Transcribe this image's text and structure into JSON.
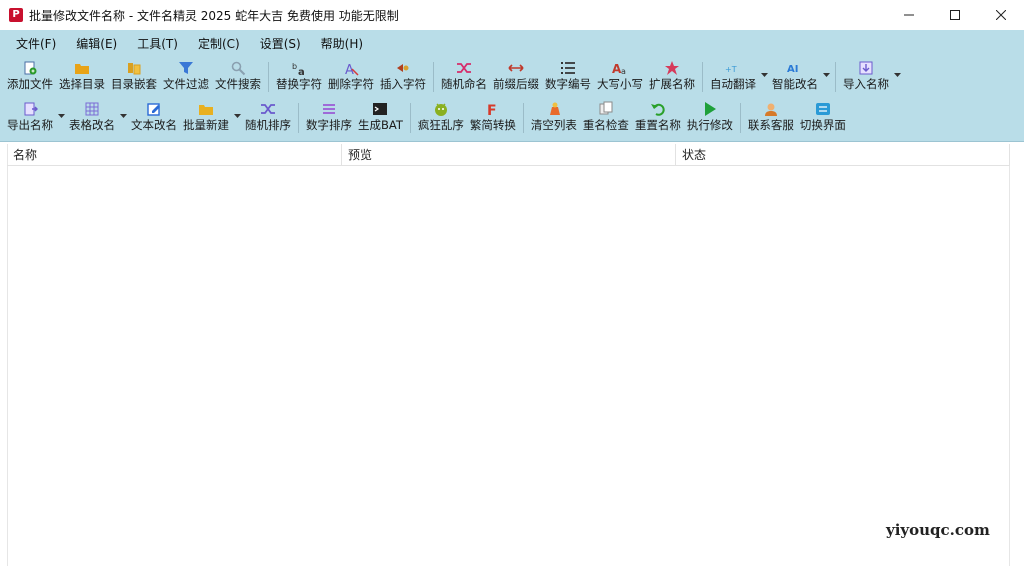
{
  "window": {
    "title": "批量修改文件名称 - 文件名精灵 2025 蛇年大吉 免费使用 功能无限制",
    "app_icon_glyph": "P",
    "controls": {
      "minimize": "—",
      "maximize": "☐",
      "close": "✕"
    }
  },
  "menu": [
    {
      "label": "文件(F)"
    },
    {
      "label": "编辑(E)"
    },
    {
      "label": "工具(T)"
    },
    {
      "label": "定制(C)"
    },
    {
      "label": "设置(S)"
    },
    {
      "label": "帮助(H)"
    }
  ],
  "toolbar_row1": [
    {
      "label": "添加文件",
      "icon": "add-file-icon",
      "color": "#4a6fa5"
    },
    {
      "label": "选择目录",
      "icon": "folder-open-icon",
      "color": "#e8a317"
    },
    {
      "label": "目录嵌套",
      "icon": "nested-folder-icon",
      "color": "#d9a020"
    },
    {
      "label": "文件过滤",
      "icon": "filter-icon",
      "color": "#3a78d6"
    },
    {
      "label": "文件搜索",
      "icon": "search-icon",
      "color": "#8aa0b0"
    },
    {
      "label": "替换字符",
      "icon": "replace-icon",
      "color": "#333333"
    },
    {
      "label": "删除字符",
      "icon": "delete-char-icon",
      "color": "#6a5acd"
    },
    {
      "label": "插入字符",
      "icon": "insert-char-icon",
      "color": "#b04020"
    },
    {
      "label": "随机命名",
      "icon": "shuffle-icon",
      "color": "#d62c6a"
    },
    {
      "label": "前缀后缀",
      "icon": "prefix-suffix-icon",
      "color": "#c0392b"
    },
    {
      "label": "数字编号",
      "icon": "numbered-list-icon",
      "color": "#333333"
    },
    {
      "label": "大写小写",
      "icon": "case-icon",
      "color": "#c0392b"
    },
    {
      "label": "扩展名称",
      "icon": "star-icon",
      "color": "#d63a5a"
    },
    {
      "label": "自动翻译",
      "icon": "translate-icon",
      "color": "#3a9ad6"
    },
    {
      "label": "智能改名",
      "icon": "ai-icon",
      "color": "#2a7ad6"
    },
    {
      "label": "导入名称",
      "icon": "import-icon",
      "color": "#6a5acd"
    }
  ],
  "toolbar_row2": [
    {
      "label": "导出名称",
      "icon": "export-icon",
      "color": "#6a5acd"
    },
    {
      "label": "表格改名",
      "icon": "table-icon",
      "color": "#7a6ad6"
    },
    {
      "label": "文本改名",
      "icon": "edit-text-icon",
      "color": "#2a6ad6"
    },
    {
      "label": "批量新建",
      "icon": "new-folder-icon",
      "color": "#e8b020"
    },
    {
      "label": "随机排序",
      "icon": "random-sort-icon",
      "color": "#6a5acd"
    },
    {
      "label": "数字排序",
      "icon": "number-sort-icon",
      "color": "#9a5ad6"
    },
    {
      "label": "生成BAT",
      "icon": "terminal-icon",
      "color": "#222222"
    },
    {
      "label": "疯狂乱序",
      "icon": "crazy-shuffle-icon",
      "color": "#8ab020"
    },
    {
      "label": "繁简转换",
      "icon": "font-convert-icon",
      "color": "#d63a2a"
    },
    {
      "label": "清空列表",
      "icon": "clear-list-icon",
      "color": "#e86a2a"
    },
    {
      "label": "重名检查",
      "icon": "duplicate-check-icon",
      "color": "#8a8a8a"
    },
    {
      "label": "重置名称",
      "icon": "undo-icon",
      "color": "#2aa02a"
    },
    {
      "label": "执行修改",
      "icon": "play-icon",
      "color": "#1ea03a"
    },
    {
      "label": "联系客服",
      "icon": "support-icon",
      "color": "#d67a2a"
    },
    {
      "label": "切换界面",
      "icon": "switch-ui-icon",
      "color": "#2a9ad6"
    }
  ],
  "list": {
    "columns": [
      "名称",
      "预览",
      "状态"
    ]
  },
  "watermark": "yiyouqc.com"
}
